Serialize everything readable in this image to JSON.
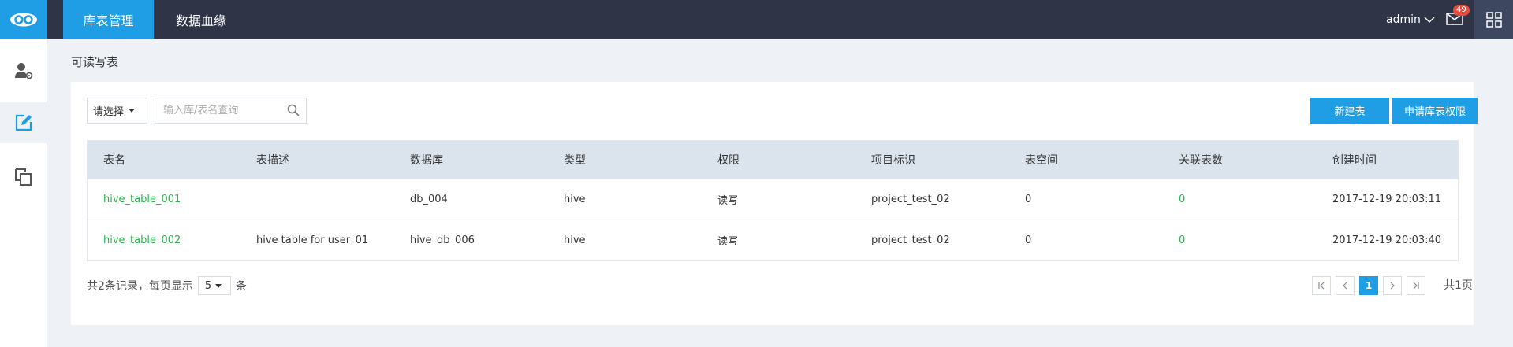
{
  "topbar": {
    "tabs": [
      {
        "label": "库表管理",
        "active": true
      },
      {
        "label": "数据血缘",
        "active": false
      }
    ],
    "user": "admin",
    "mail_count": "49"
  },
  "sidebar": {
    "items": [
      {
        "icon": "user-settings-icon",
        "active": false
      },
      {
        "icon": "edit-icon",
        "active": true
      },
      {
        "icon": "copy-icon",
        "active": false
      }
    ]
  },
  "page": {
    "title": "可读写表"
  },
  "filters": {
    "select_label": "请选择",
    "search_placeholder": "输入库/表名查询"
  },
  "buttons": {
    "new_table": "新建表",
    "apply_permission": "申请库表权限"
  },
  "table": {
    "columns": [
      "表名",
      "表描述",
      "数据库",
      "类型",
      "权限",
      "项目标识",
      "表空间",
      "关联表数",
      "创建时间"
    ],
    "rows": [
      [
        "hive_table_001",
        "",
        "db_004",
        "hive",
        "读写",
        "project_test_02",
        "0",
        "0",
        "2017-12-19 20:03:11"
      ],
      [
        "hive_table_002",
        "hive table for user_01",
        "hive_db_006",
        "hive",
        "读写",
        "project_test_02",
        "0",
        "0",
        "2017-12-19 20:03:40"
      ]
    ]
  },
  "footer": {
    "records_text": "共2条记录，每页显示",
    "page_size": "5",
    "unit": "条",
    "current_page": "1",
    "total_pages_text": "共1页"
  },
  "colors": {
    "accent": "#1f9ee6",
    "topbar": "#2f3447",
    "link_green": "#2bb24c"
  }
}
